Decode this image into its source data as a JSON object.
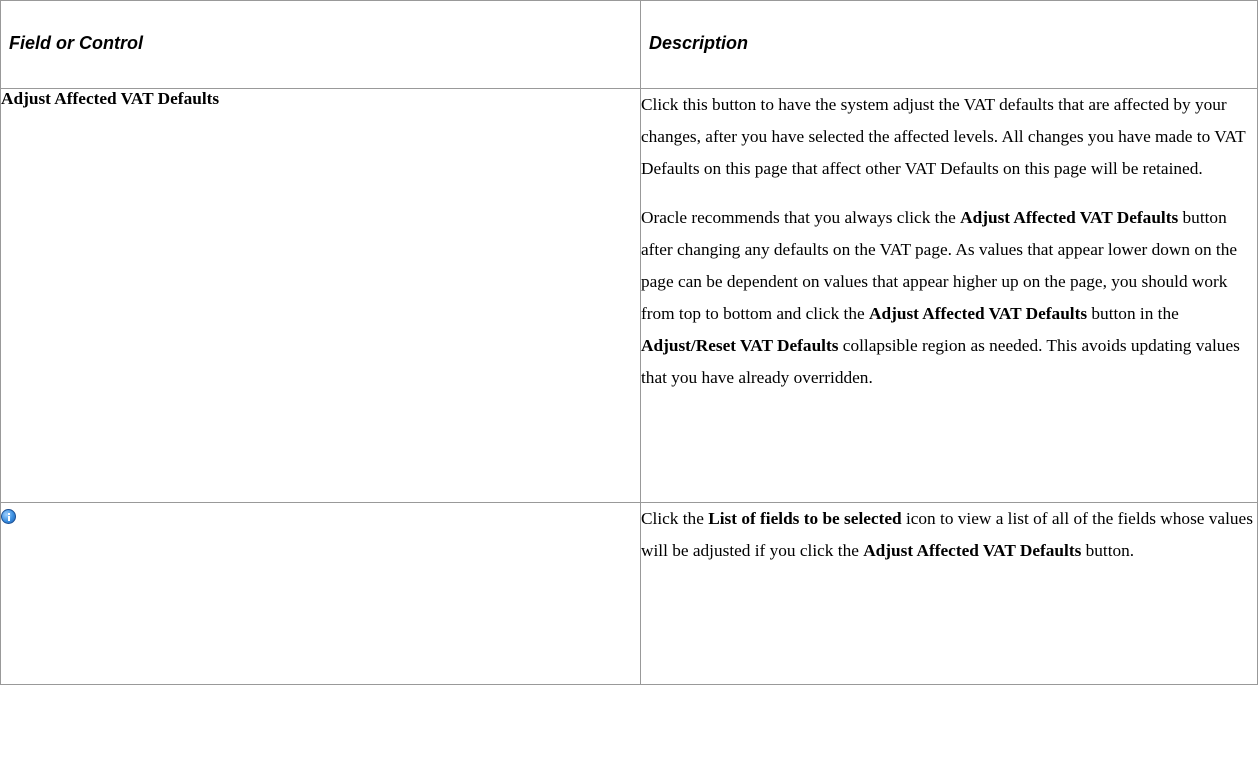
{
  "table": {
    "headers": [
      "Field or Control",
      "Description"
    ],
    "row1": {
      "field": "Adjust Affected VAT Defaults",
      "desc_p1": "Click this button to have the system adjust the VAT defaults that are affected by your changes, after you have selected the affected levels. All changes you have made to VAT Defaults on this page that affect other VAT Defaults on this page will be retained.",
      "desc_p2": [
        "Oracle recommends that you always click the ",
        "Adjust Affected VAT Defaults",
        " button after changing any defaults on the VAT page. As values that appear lower down on the page can be dependent on values that appear higher up on the page, you should work from top to bottom and click the ",
        "Adjust Affected VAT Defaults",
        " button in the ",
        "Adjust/Reset VAT Defaults",
        " collapsible region as needed. This avoids updating values that you have already overridden."
      ]
    },
    "row2": {
      "field_icon": "info-icon",
      "desc": [
        "Click the ",
        "List of fields to be selected",
        " icon to view a list of all of the fields whose values will be adjusted if you click the ",
        "Adjust Affected VAT Defaults",
        " button."
      ]
    }
  }
}
